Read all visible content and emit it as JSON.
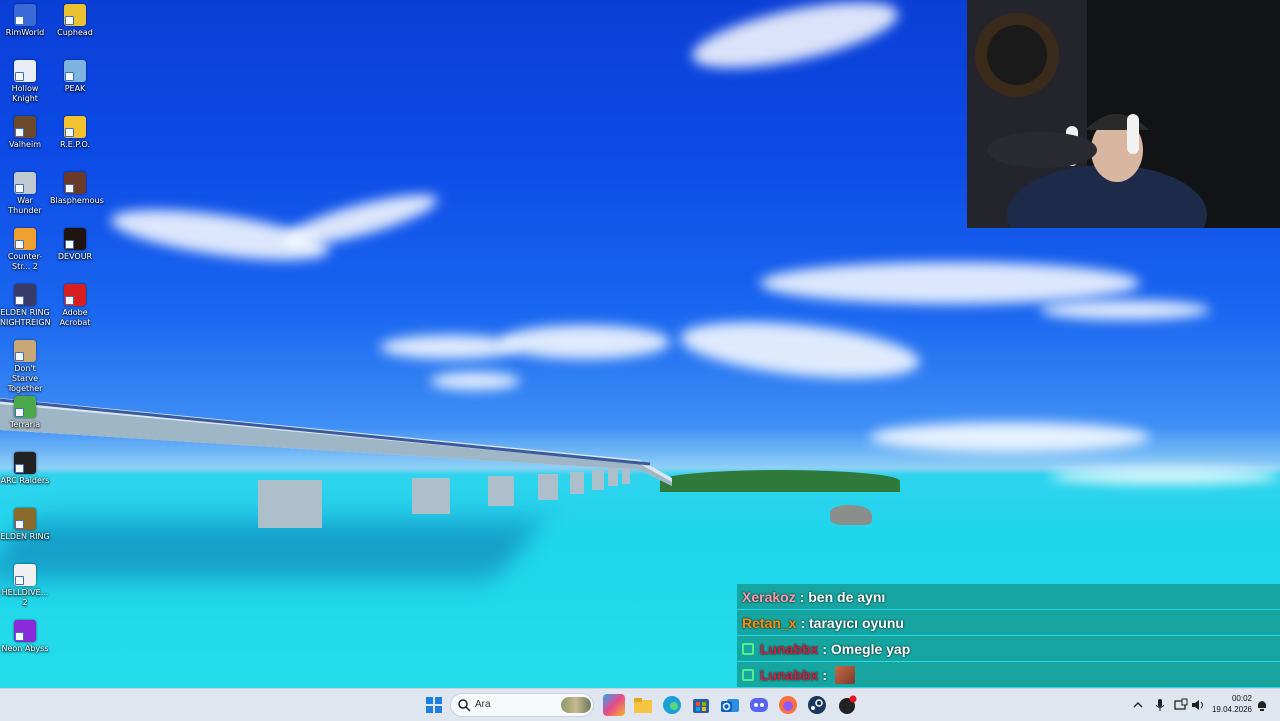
{
  "desktop_icons": [
    {
      "label": "RimWorld",
      "color": "#3a6ad8"
    },
    {
      "label": "Cuphead",
      "color": "#e8c230"
    },
    {
      "label": "Hollow Knight",
      "color": "#e9eef6"
    },
    {
      "label": "PEAK",
      "color": "#7fb3e0"
    },
    {
      "label": "Valheim",
      "color": "#6a4a2a"
    },
    {
      "label": "R.E.P.O.",
      "color": "#f2c230"
    },
    {
      "label": "War Thunder",
      "color": "#c0c8d0"
    },
    {
      "label": "Blasphemous",
      "color": "#6a3a2a"
    },
    {
      "label": "Counter-Str... 2",
      "color": "#f0a030"
    },
    {
      "label": "DEVOUR",
      "color": "#201410"
    },
    {
      "label": "ELDEN RING NIGHTREIGN",
      "color": "#3a3a6a"
    },
    {
      "label": "Adobe Acrobat",
      "color": "#d81e1e"
    },
    {
      "label": "Don't Starve Together",
      "color": "#c8a878"
    },
    {
      "label": "Terraria",
      "color": "#4aa84a"
    },
    {
      "label": "ARC Raiders",
      "color": "#222222"
    },
    {
      "label": "ELDEN RING",
      "color": "#8a6a2a"
    },
    {
      "label": "HELLDIVE... 2",
      "color": "#f0f0f0"
    },
    {
      "label": "Neon Abyss",
      "color": "#8a2ad8"
    }
  ],
  "chat": [
    {
      "user": "Xerakoz",
      "user_color": "#ff9aa8",
      "message": ": ben de aynı",
      "badge": false
    },
    {
      "user": "Retan_x",
      "user_color": "#ff8c00",
      "message": ": tarayıcı oyunu",
      "badge": false
    },
    {
      "user": "Lunabbx",
      "user_color": "#d81b3c",
      "message": ": Omegle yap",
      "badge": true
    },
    {
      "user": "Lunabbx",
      "user_color": "#d81b3c",
      "message": ":",
      "badge": true
    }
  ],
  "taskbar": {
    "search_placeholder": "Ara",
    "apps": [
      "windows-start",
      "search",
      "widgets",
      "copilot",
      "file-explorer",
      "edge",
      "store",
      "outlook",
      "discord",
      "firefox",
      "steam",
      "app-notification"
    ],
    "time": "00:02",
    "date": "19.04.2026"
  },
  "colors": {
    "taskbar": "#dfe6f0",
    "chat_row": "#14968c",
    "accent": "#0067c0"
  }
}
